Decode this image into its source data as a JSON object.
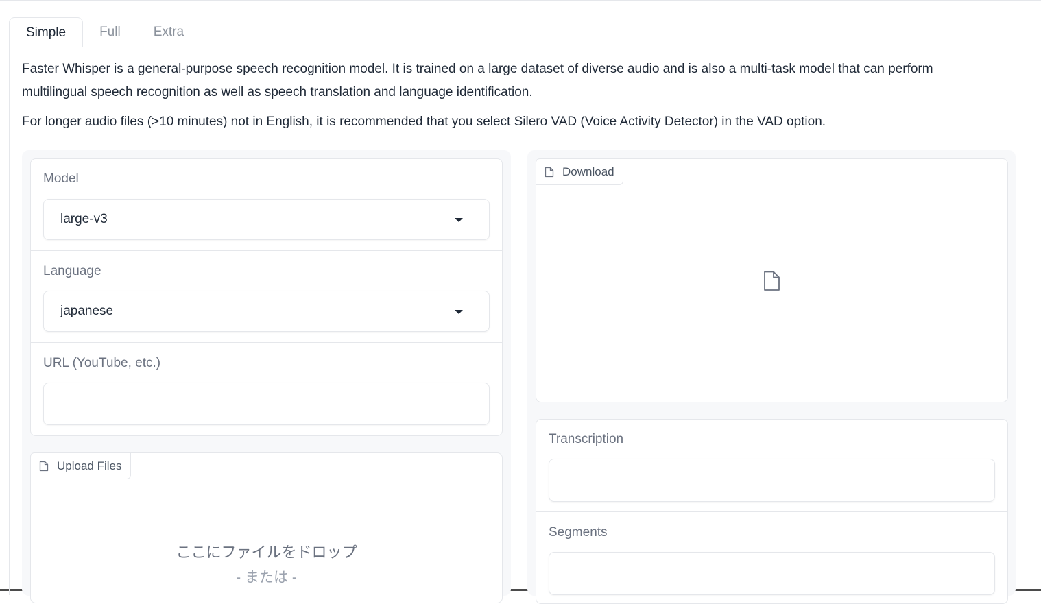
{
  "tabs": [
    {
      "label": "Simple",
      "selected": true
    },
    {
      "label": "Full",
      "selected": false
    },
    {
      "label": "Extra",
      "selected": false
    }
  ],
  "description": {
    "line1": "Faster Whisper is a general-purpose speech recognition model. It is trained on a large dataset of diverse audio and is also a multi-task model that can perform multilingual speech recognition as well as speech translation and language identification.",
    "line2": "For longer audio files (>10 minutes) not in English, it is recommended that you select Silero VAD (Voice Activity Detector) in the VAD option."
  },
  "left": {
    "model": {
      "label": "Model",
      "value": "large-v3"
    },
    "language": {
      "label": "Language",
      "value": "japanese"
    },
    "url": {
      "label": "URL (YouTube, etc.)",
      "value": ""
    },
    "upload": {
      "label": "Upload Files",
      "drop_text": "ここにファイルをドロップ",
      "or_text": "- または -"
    }
  },
  "right": {
    "download": {
      "label": "Download"
    },
    "transcription": {
      "label": "Transcription",
      "value": ""
    },
    "segments": {
      "label": "Segments",
      "value": ""
    }
  },
  "icons": [
    "file-icon",
    "chevron-down-icon"
  ]
}
